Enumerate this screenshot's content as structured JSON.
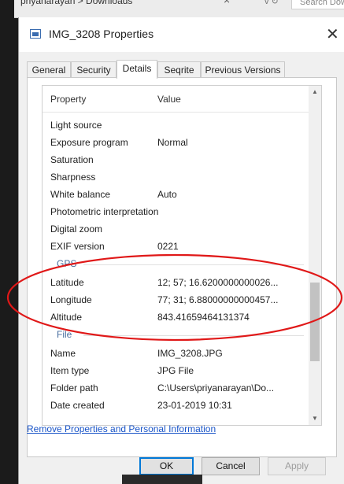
{
  "background": {
    "breadcrumb": "priyanarayan > Downloads",
    "nav_chevrons": "v  ↻",
    "search_placeholder": "Search Dow"
  },
  "dialog": {
    "title": "IMG_3208 Properties",
    "tabs": [
      "General",
      "Security",
      "Details",
      "Seqrite",
      "Previous Versions"
    ],
    "active_tab": "Details"
  },
  "details": {
    "header": {
      "property": "Property",
      "value": "Value"
    },
    "rows_top": [
      {
        "key": "Light source",
        "value": ""
      },
      {
        "key": "Exposure program",
        "value": "Normal"
      },
      {
        "key": "Saturation",
        "value": ""
      },
      {
        "key": "Sharpness",
        "value": ""
      },
      {
        "key": "White balance",
        "value": "Auto"
      },
      {
        "key": "Photometric interpretation",
        "value": ""
      },
      {
        "key": "Digital zoom",
        "value": ""
      },
      {
        "key": "EXIF version",
        "value": "0221"
      }
    ],
    "gps_section": "GPS",
    "gps_rows": [
      {
        "key": "Latitude",
        "value": "12; 57; 16.6200000000026..."
      },
      {
        "key": "Longitude",
        "value": "77; 31; 6.88000000000457..."
      },
      {
        "key": "Altitude",
        "value": "843.41659464131374"
      }
    ],
    "file_section": "File",
    "file_rows": [
      {
        "key": "Name",
        "value": "IMG_3208.JPG"
      },
      {
        "key": "Item type",
        "value": "JPG File"
      },
      {
        "key": "Folder path",
        "value": "C:\\Users\\priyanarayan\\Do..."
      },
      {
        "key": "Date created",
        "value": "23-01-2019 10:31"
      }
    ]
  },
  "remove_link": "Remove Properties and Personal Information",
  "buttons": {
    "ok": "OK",
    "cancel": "Cancel",
    "apply": "Apply"
  },
  "colors": {
    "annotation": "#e01818",
    "link": "#1a55c8",
    "section": "#4a6fa0"
  }
}
